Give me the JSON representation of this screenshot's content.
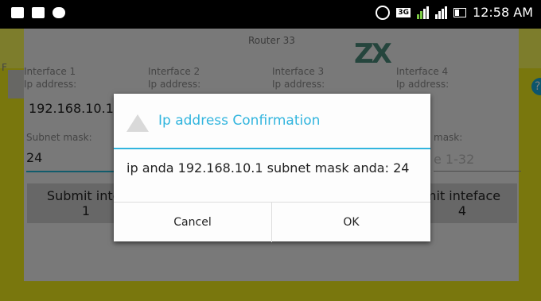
{
  "statusbar": {
    "time": "12:58 AM",
    "network": "3G"
  },
  "app": {
    "title": "Router 33",
    "logo": "ZX",
    "f_text": "F",
    "interfaces": [
      {
        "name": "Interface 1",
        "ip_label": "Ip address:"
      },
      {
        "name": "Interface 2",
        "ip_label": "Ip address:"
      },
      {
        "name": "Interface 3",
        "ip_label": "Ip address:"
      },
      {
        "name": "Interface 4",
        "ip_label": "Ip address:"
      }
    ],
    "ip1_value": "192.168.10.1",
    "subnet_label": "Subnet mask:",
    "subnet_value": "24",
    "subnet_label_4": "mask:",
    "subnet_placeholder_4": "e 1-32",
    "submit1": "Submit intef",
    "submit1_num": "1",
    "submit4": "mit inteface",
    "submit4_num": "4"
  },
  "dialog": {
    "title": "Ip address Confirmation",
    "message": "ip anda 192.168.10.1 subnet mask anda: 24",
    "cancel": "Cancel",
    "ok": "OK"
  }
}
